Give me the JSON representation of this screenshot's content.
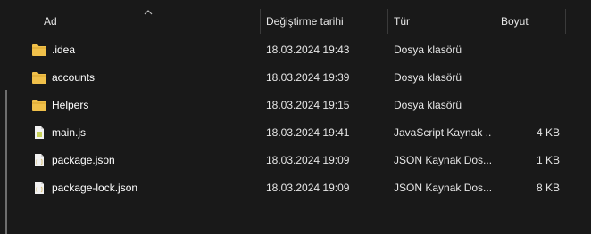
{
  "columns": {
    "name": "Ad",
    "modified": "Değiştirme tarihi",
    "type": "Tür",
    "size": "Boyut"
  },
  "sort_icon": "chevron-up-icon",
  "rows": [
    {
      "name": ".idea",
      "modified": "18.03.2024 19:43",
      "type": "Dosya klasörü",
      "size": "",
      "icon": "folder-icon"
    },
    {
      "name": "accounts",
      "modified": "18.03.2024 19:39",
      "type": "Dosya klasörü",
      "size": "",
      "icon": "folder-icon"
    },
    {
      "name": "Helpers",
      "modified": "18.03.2024 19:15",
      "type": "Dosya klasörü",
      "size": "",
      "icon": "folder-icon"
    },
    {
      "name": "main.js",
      "modified": "18.03.2024 19:41",
      "type": "JavaScript Kaynak ...",
      "size": "4 KB",
      "icon": "js-file-icon"
    },
    {
      "name": "package.json",
      "modified": "18.03.2024 19:09",
      "type": "JSON Kaynak Dos...",
      "size": "1 KB",
      "icon": "json-file-icon"
    },
    {
      "name": "package-lock.json",
      "modified": "18.03.2024 19:09",
      "type": "JSON Kaynak Dos...",
      "size": "8 KB",
      "icon": "json-file-icon"
    }
  ],
  "colors": {
    "background": "#191919",
    "folder": "#f0c04a",
    "js_accent": "#c9d35b",
    "json_accent": "#d8c07a"
  }
}
